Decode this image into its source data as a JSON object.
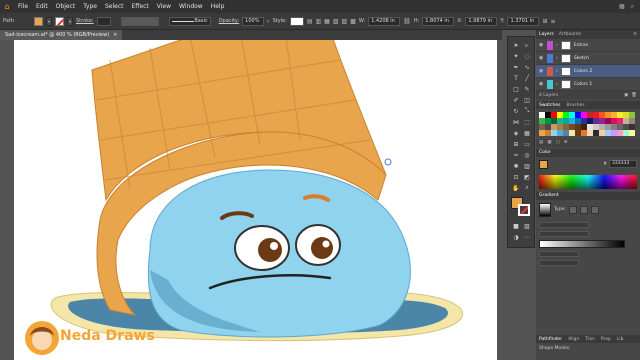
{
  "menubar": {
    "items": [
      "File",
      "Edit",
      "Object",
      "Type",
      "Select",
      "Effect",
      "View",
      "Window",
      "Help"
    ]
  },
  "control_bar": {
    "object_label": "Path",
    "stroke_label": "Stroke:",
    "brush_value": "Basic",
    "opacity_label": "Opacity:",
    "opacity_value": "100%",
    "style_label": "Style:",
    "w_value": "1.4208 in",
    "h_value": "1.8074 in",
    "x_value": "1.9879 in",
    "y_value": "1.3701 in"
  },
  "document": {
    "tab_title": "Sad-icecream.ai* @ 400 % (RGB/Preview)",
    "close_glyph": "×"
  },
  "layers_panel": {
    "tabs": [
      "Layers",
      "Artboards"
    ],
    "rows": [
      {
        "name": "Extras",
        "color": "#c64bd6",
        "selected": false
      },
      {
        "name": "Sketch",
        "color": "#4b7bd6",
        "selected": false
      },
      {
        "name": "Colors 2",
        "color": "#d6574b",
        "selected": true
      },
      {
        "name": "Colors 1",
        "color": "#4bc6d6",
        "selected": false
      }
    ],
    "footer": "4 Layers"
  },
  "swatches_panel": {
    "tabs": [
      "Swatches",
      "Brushes"
    ]
  },
  "color_panel": {
    "title": "Color",
    "hex_label": "#",
    "hex_value": "333333"
  },
  "gradient_panel": {
    "title": "Gradient",
    "type_label": "Type:"
  },
  "pathfinder_panel": {
    "tabs": [
      "Pathfinder",
      "Align",
      "Tran",
      "Prop",
      "Lib"
    ],
    "shape_modes_label": "Shape Modes:"
  },
  "watermark": {
    "text": "Neda Draws"
  },
  "colors": {
    "cone": "#e9a54c",
    "cone_dark": "#c98030",
    "face": "#8fd3ee",
    "face_shadow": "#5fa8c8",
    "puddle": "#4b86a8",
    "cream": "#f4e5a8",
    "fill_swatch": "#e9a54c"
  }
}
